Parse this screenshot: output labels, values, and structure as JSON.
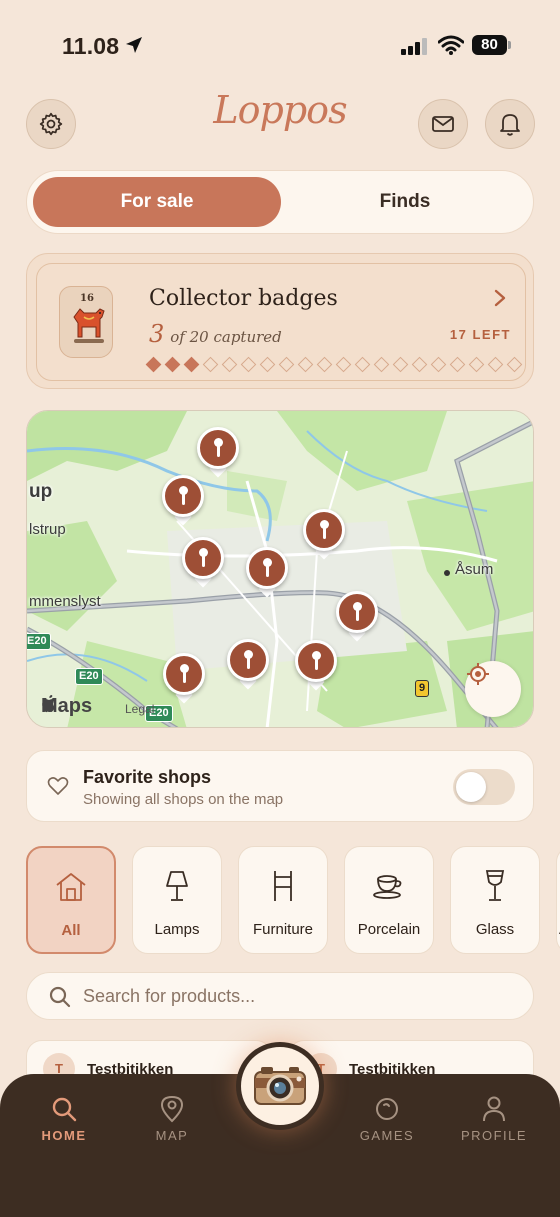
{
  "status_bar": {
    "time": "11.08",
    "battery": "80"
  },
  "header": {
    "logo": "Loppos"
  },
  "segmented": {
    "for_sale": "For sale",
    "finds": "Finds"
  },
  "badges": {
    "count": "16",
    "title": "Collector badges",
    "captured_num": "3",
    "captured_text": "of 20 captured",
    "left": "17 LEFT",
    "captured": 3,
    "total": 20
  },
  "map": {
    "labels": [
      "up",
      "lstrup",
      "mmenslyst",
      "Åsum"
    ],
    "shields": [
      "E20",
      "E20",
      "E20",
      "9"
    ],
    "brand": "Maps",
    "legal": "Legal"
  },
  "favorite": {
    "title": "Favorite shops",
    "subtitle": "Showing all shops on the map",
    "enabled": false
  },
  "categories": [
    {
      "label": "All",
      "icon": "home-icon",
      "active": true
    },
    {
      "label": "Lamps",
      "icon": "lamp-icon",
      "active": false
    },
    {
      "label": "Furniture",
      "icon": "chair-icon",
      "active": false
    },
    {
      "label": "Porcelain",
      "icon": "teacup-icon",
      "active": false
    },
    {
      "label": "Glass",
      "icon": "wine-glass-icon",
      "active": false
    },
    {
      "label": "A",
      "icon": "more-icon",
      "active": false
    }
  ],
  "search": {
    "placeholder": "Search for products..."
  },
  "products": [
    {
      "avatar": "T",
      "shop": "Testbitikken"
    },
    {
      "avatar": "T",
      "shop": "Testbitikken"
    }
  ],
  "nav": {
    "home": "HOME",
    "map": "MAP",
    "games": "GAMES",
    "profile": "PROFILE"
  },
  "colors": {
    "accent": "#c8765a",
    "background": "#f5e6d9",
    "nav": "#3d2d22",
    "pin": "#9e4f36"
  }
}
